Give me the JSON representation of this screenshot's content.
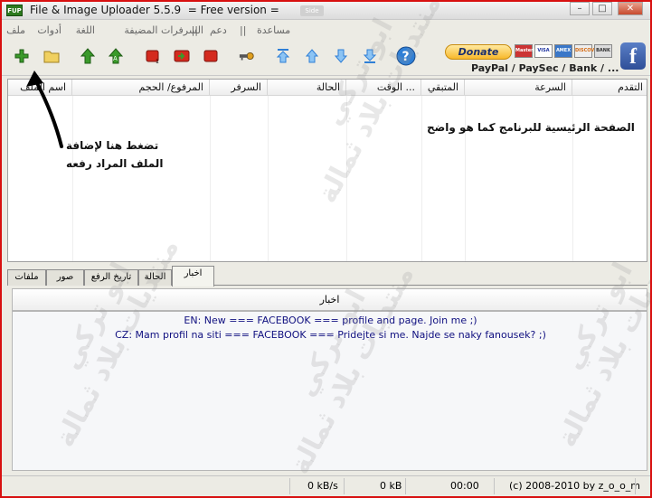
{
  "window": {
    "title": "File & Image Uploader 5.5.9  = Free version =",
    "icon_text": "FUP",
    "ghost_tab": "Side"
  },
  "menu": {
    "items": [
      "ملف",
      "أدوات",
      "اللغة",
      "السرفرات المضيفة",
      "||",
      "دعم",
      "||",
      "مساعدة"
    ]
  },
  "toolbar": {
    "donate_label": "Donate",
    "payment_text": "PayPal / PaySec / Bank / ...",
    "cards": [
      "MasterCard",
      "VISA",
      "AMEX",
      "DISCOVER",
      "BANK"
    ],
    "facebook_letter": "f",
    "accent_green": "#3a9a2a",
    "accent_red": "#d42a1e",
    "accent_blue": "#2f7fd6"
  },
  "columns": [
    "اسم الملف",
    "المرفوع/ الحجم",
    "السرفر",
    "الحالة",
    "... الوقت",
    "المتبقي",
    "السرعة",
    "التقدم"
  ],
  "annotations": {
    "hint_line1": "تضغط هنا لإضافة",
    "hint_line2": "الملف المراد رفعه",
    "main_note": "الصفحة الرئيسية للبرنامج كما هو واضح"
  },
  "tabs": [
    "ملفات",
    "صور",
    "تاريخ الرفع",
    "الحالة",
    "اخبار"
  ],
  "news": {
    "header": "اخبار",
    "lines": [
      "EN: New === FACEBOOK === profile and page. Join me ;)",
      "CZ: Mam profil na siti === FACEBOOK === Pridejte si me. Najde se naky fanousek? ;)"
    ]
  },
  "status": {
    "speed": "0 kB/s",
    "size": "0 kB",
    "time": "00:00",
    "copyright": "(c) 2008-2010 by z_o_o_m"
  },
  "watermark": {
    "line1": "ابو تركي",
    "line2": "منتديات بلاد ثمالة"
  }
}
